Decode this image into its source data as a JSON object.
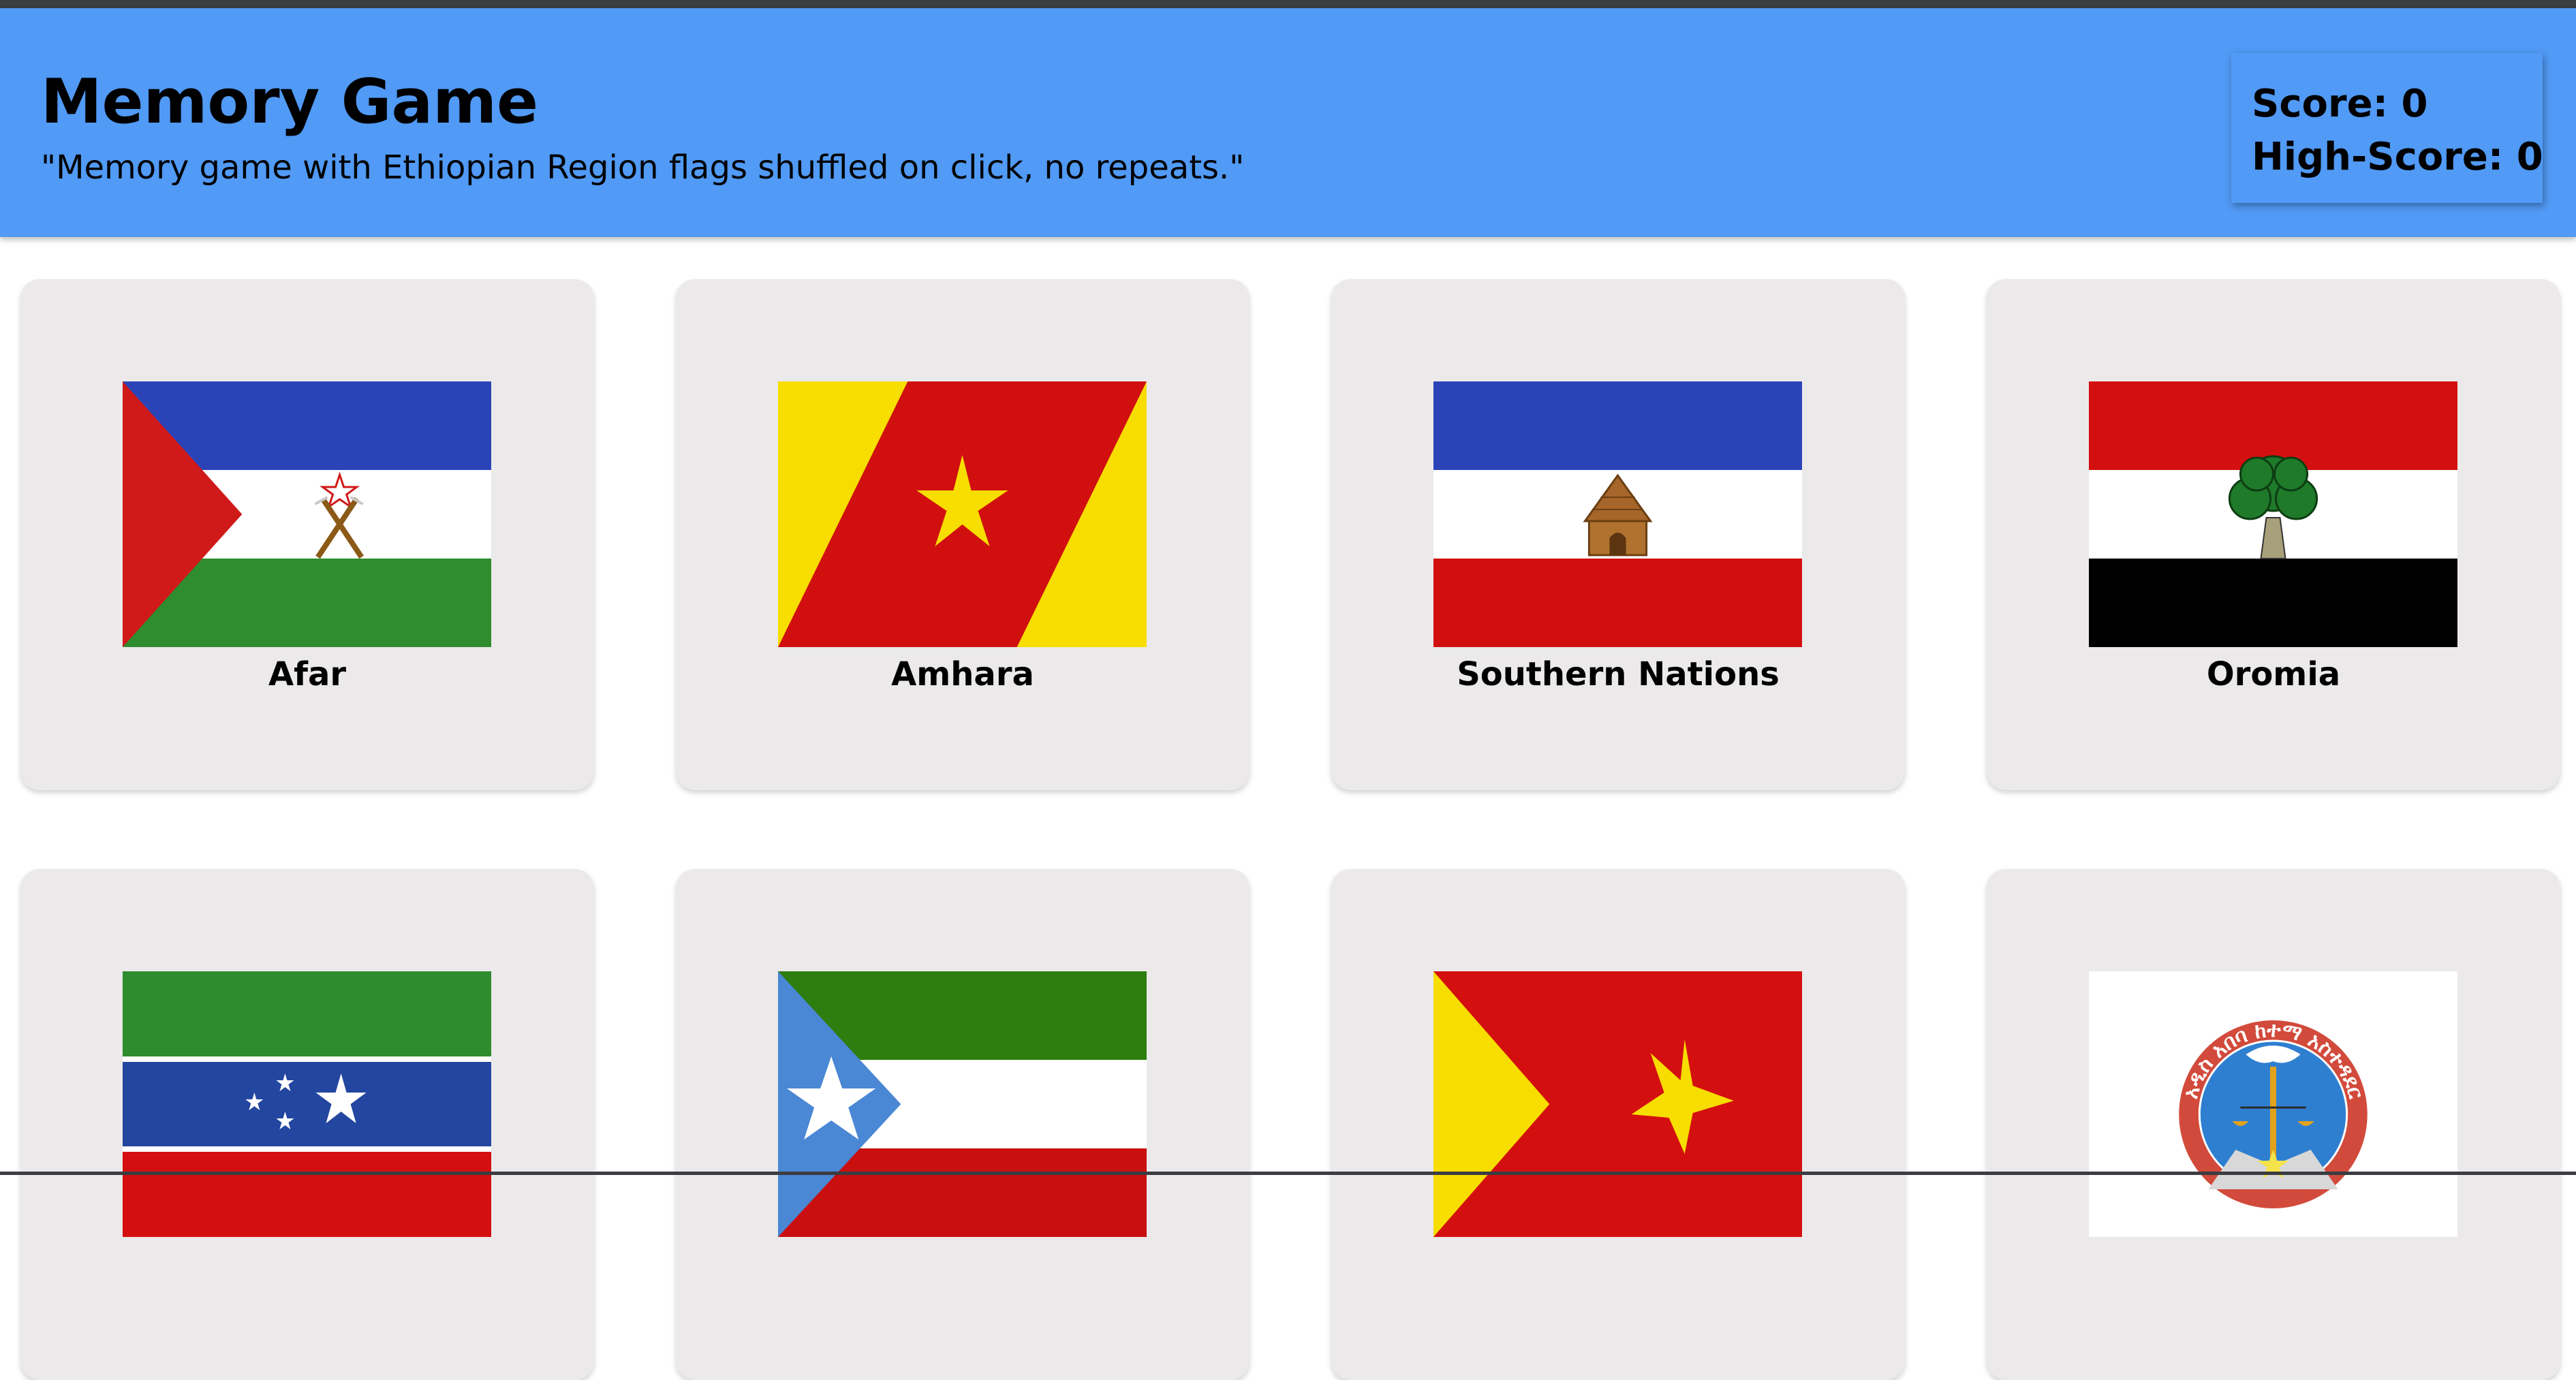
{
  "header": {
    "title": "Memory Game",
    "subtitle": "\"Memory game with Ethiopian Region flags shuffled on click, no repeats.\"",
    "score_text": "Score: 0",
    "high_score_text": "High-Score: 0",
    "score": 0,
    "high_score": 0,
    "background_color": "#519af5"
  },
  "cards": [
    {
      "label": "Afar",
      "flag": "afar-flag"
    },
    {
      "label": "Amhara",
      "flag": "amhara-flag"
    },
    {
      "label": "Southern Nations",
      "flag": "southern-nations-flag"
    },
    {
      "label": "Oromia",
      "flag": "oromia-flag"
    },
    {
      "label": "",
      "flag": "somali-flag"
    },
    {
      "label": "",
      "flag": "benishangul-gumuz-flag"
    },
    {
      "label": "",
      "flag": "tigray-flag"
    },
    {
      "label": "",
      "flag": "addis-ababa-emblem",
      "emblem_text": "አዲስ አበባ ከተማ አስተዳደር"
    }
  ]
}
